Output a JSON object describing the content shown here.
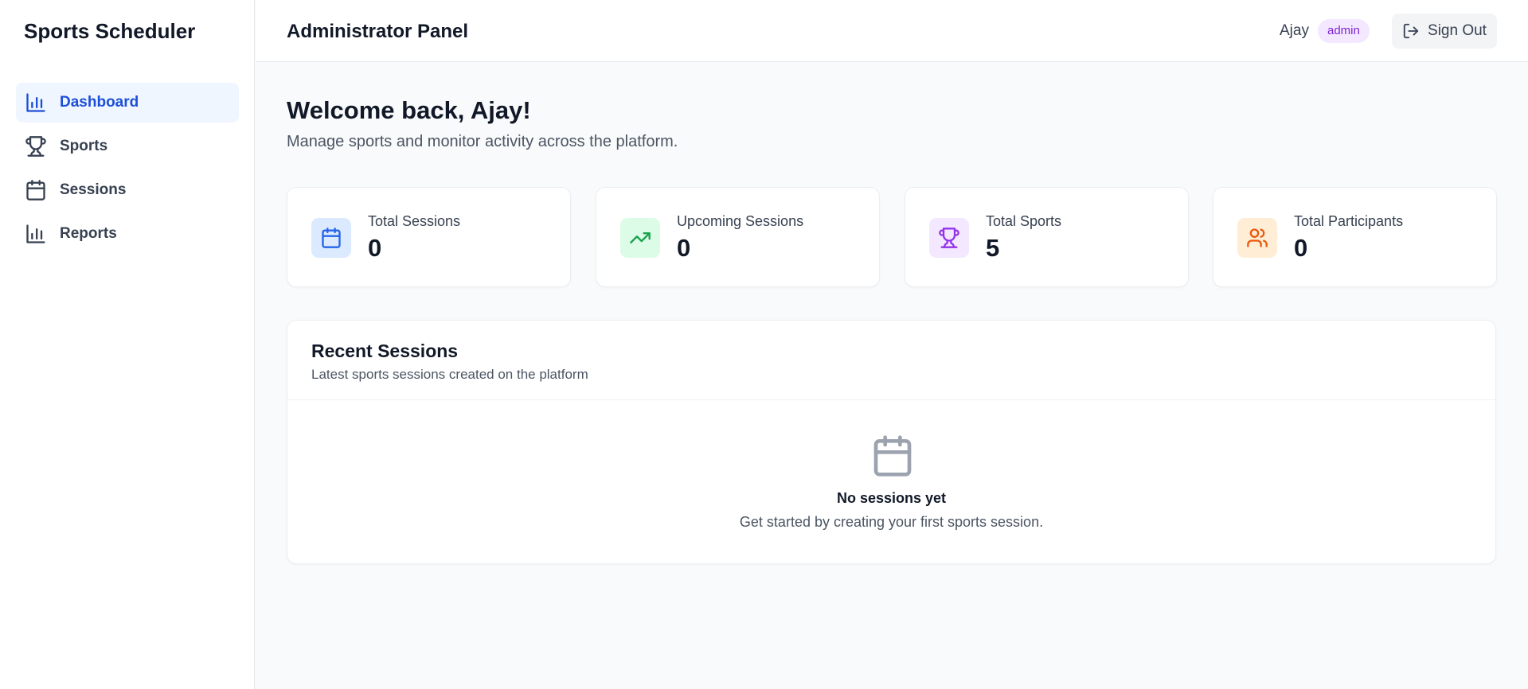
{
  "app": {
    "title": "Sports Scheduler"
  },
  "sidebar": {
    "items": [
      {
        "label": "Dashboard",
        "icon": "bar-chart-icon",
        "active": true
      },
      {
        "label": "Sports",
        "icon": "trophy-icon",
        "active": false
      },
      {
        "label": "Sessions",
        "icon": "calendar-icon",
        "active": false
      },
      {
        "label": "Reports",
        "icon": "bar-chart-icon",
        "active": false
      }
    ]
  },
  "header": {
    "title": "Administrator Panel",
    "user_name": "Ajay",
    "role": "admin",
    "signout_label": "Sign Out",
    "signout_icon": "log-out-icon"
  },
  "welcome": {
    "title": "Welcome back, Ajay!",
    "subtitle": "Manage sports and monitor activity across the platform."
  },
  "stats": [
    {
      "label": "Total Sessions",
      "value": "0",
      "icon": "calendar-icon",
      "color": "#2563eb",
      "bg": "#dbeafe"
    },
    {
      "label": "Upcoming Sessions",
      "value": "0",
      "icon": "trending-up-icon",
      "color": "#16a34a",
      "bg": "#dcfce7"
    },
    {
      "label": "Total Sports",
      "value": "5",
      "icon": "trophy-icon",
      "color": "#9333ea",
      "bg": "#f3e8ff"
    },
    {
      "label": "Total Participants",
      "value": "0",
      "icon": "users-icon",
      "color": "#ea580c",
      "bg": "#ffedd5"
    }
  ],
  "recent": {
    "title": "Recent Sessions",
    "subtitle": "Latest sports sessions created on the platform",
    "empty_icon": "calendar-icon",
    "empty_title": "No sessions yet",
    "empty_subtitle": "Get started by creating your first sports session."
  },
  "colors": {
    "accent": "#1d4ed8",
    "active_bg": "#eff6ff",
    "badge_bg": "#f3e8ff",
    "badge_text": "#7e22ce"
  }
}
